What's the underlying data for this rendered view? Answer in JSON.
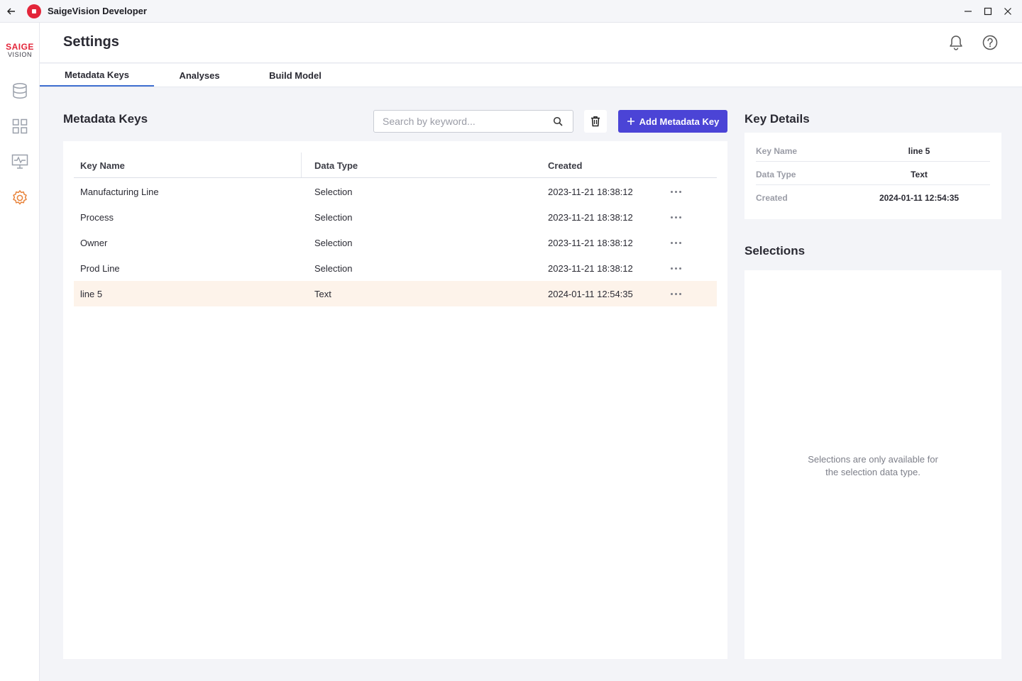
{
  "window": {
    "title": "SaigeVision Developer"
  },
  "brand": {
    "top": "SAIGE",
    "bottom": "VISION"
  },
  "sidebar": {
    "items": [
      {
        "name": "database-icon"
      },
      {
        "name": "grid-icon"
      },
      {
        "name": "monitor-icon"
      },
      {
        "name": "gear-icon",
        "active": true
      }
    ]
  },
  "header": {
    "title": "Settings"
  },
  "tabs": [
    {
      "label": "Metadata Keys",
      "active": true
    },
    {
      "label": "Analyses"
    },
    {
      "label": "Build Model"
    }
  ],
  "metadata": {
    "title": "Metadata Keys",
    "search_placeholder": "Search by keyword...",
    "add_label": "Add Metadata Key",
    "columns": [
      "Key Name",
      "Data Type",
      "Created"
    ],
    "rows": [
      {
        "key": "Manufacturing Line",
        "type": "Selection",
        "created": "2023-11-21 18:38:12"
      },
      {
        "key": "Process",
        "type": "Selection",
        "created": "2023-11-21 18:38:12"
      },
      {
        "key": "Owner",
        "type": "Selection",
        "created": "2023-11-21 18:38:12"
      },
      {
        "key": "Prod Line",
        "type": "Selection",
        "created": "2023-11-21 18:38:12"
      },
      {
        "key": "line 5",
        "type": "Text",
        "created": "2024-01-11 12:54:35",
        "selected": true
      }
    ]
  },
  "details": {
    "title": "Key Details",
    "fields": [
      {
        "label": "Key Name",
        "value": "line 5"
      },
      {
        "label": "Data Type",
        "value": "Text"
      },
      {
        "label": "Created",
        "value": "2024-01-11 12:54:35"
      }
    ]
  },
  "selections": {
    "title": "Selections",
    "empty_line1": "Selections are only available for",
    "empty_line2": "the selection data type."
  },
  "colors": {
    "accent": "#4b44d6",
    "tab_underline": "#3f6fd0",
    "brand_red": "#e3263a",
    "selected_row": "#fdf3ea",
    "active_nav": "#e8833a"
  }
}
